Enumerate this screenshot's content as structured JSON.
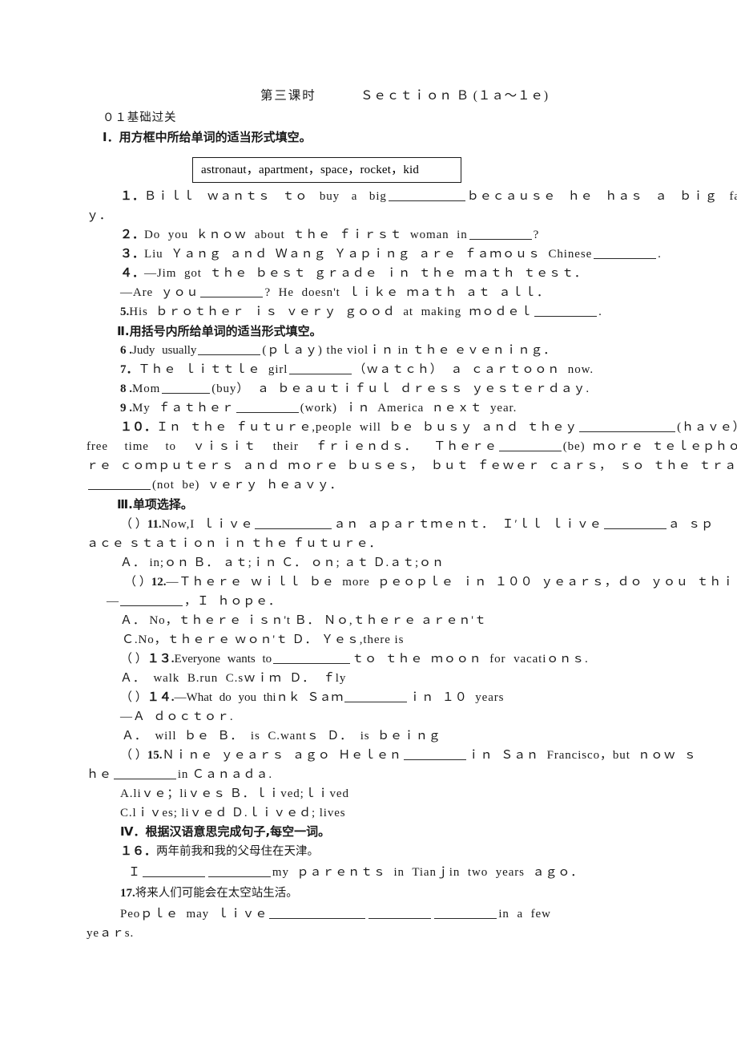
{
  "document": {
    "header": {
      "lesson_label": "第三课时",
      "section_label": "Ｓｅｃｔｉｏｎ Ｂ (１ａ～１ｅ)"
    },
    "part_label": "０１基础过关",
    "sections": [
      {
        "heading": "Ⅰ．用方框中所给单词的适当形式填空。",
        "word_bank": "astronaut，apartment，space，rocket，kid"
      },
      {
        "heading": "Ⅱ.用括号内所给单词的适当形式填空。"
      },
      {
        "heading": "Ⅲ.单项选择。"
      },
      {
        "heading": "Ⅳ．根据汉语意思完成句子,每空一词。"
      }
    ],
    "questions": [
      {
        "number": "１．",
        "lines": [
          "Ｂｉｌｌ ｗａｎｔｓ ｔｏ buy a big",
          "ｂｅｃａｕｓｅ ｈｅ ｈａｓ ａ ｂｉｇ famil",
          "ｙ．"
        ]
      },
      {
        "number": "２．",
        "lines": [
          "Do you ｋｎｏｗ about ｔｈｅ ｆｉｒｓｔ woman in",
          "?"
        ]
      },
      {
        "number": "３．",
        "lines": [
          "Liu Ｙａｎｇ ａｎｄ Ｗａｎｇ Ｙａｐｉｎｇ ａｒｅ ｆａｍｏｕｓ Chinese",
          "."
        ]
      },
      {
        "number": "４．",
        "lines": [
          "—Jim got ｔｈｅ ｂｅｓｔ ｇｒａｄｅ ｉｎ ｔｈｅ ｍａｔｈ ｔｅｓｔ．",
          "—Are ｙｏｕ",
          "? He doesn't ｌｉｋｅ ｍａｔｈ ａｔ ａｌｌ．"
        ]
      },
      {
        "number": "5.",
        "lines": [
          "His ｂｒｏｔｈｅｒ ｉｓ ｖｅｒｙ ｇｏｏｄ at making ｍｏｄｅｌ",
          "."
        ]
      },
      {
        "number": "6 .",
        "lines": [
          "Judy usually",
          "(ｐｌａｙ) the violｉｎ in ｔｈｅ ｅｖｅｎｉｎｇ．"
        ]
      },
      {
        "number": "7．",
        "lines": [
          "Ｔｈｅ ｌｉｔｔｌｅ girl",
          "（ｗａｔｃｈ） ａ ｃａｒｔｏｏｎ now."
        ]
      },
      {
        "number": "8 .",
        "lines": [
          "Mom",
          "(buy） ａ ｂｅａｕｔｉｆｕｌ ｄｒｅｓｓ ｙｅｓｔｅｒｄａｙ."
        ]
      },
      {
        "number": "9 .",
        "lines": [
          "My ｆａｔｈｅｒ",
          "(work) ｉｎ America ｎｅｘｔ year."
        ]
      },
      {
        "number": "１０．",
        "lines": [
          "Ｉｎ ｔｈｅ ｆｕｔｕｒｅ,people will ｂｅ ｂｕｓｙ ａｎｄ ｔｈｅｙ",
          "(ｈａｖｅ） ｌｅｓｓ",
          "free time to ｖｉｓｉｔ their ｆｒｉｅｎｄｓ． Ｔｈｅｒｅ",
          "(be) ｍｏｒｅ ｔｅｌｅｐｈｏｎｅｓ,ｍｏ",
          "ｒｅ ｃｏｍｐｕｔｅｒｓ ａｎｄ ｍｏｒｅ ｂｕｓｅｓ， ｂｕｔ ｆｅｗｅｒ ｃａｒｓ， ｓｏ ｔｈｅ ｔｒａｆｆｉｃ(交通)",
          "(not be) ｖｅｒｙ ｈｅａｖｙ．"
        ]
      },
      {
        "number": "11.",
        "bracket": "（    ）",
        "lines": [
          "Now,I ｌｉｖｅ",
          "ａｎ ａｐａｒｔｍｅｎｔ． Ｉ′ｌｌ ｌｉｖｅ",
          "ａ ｓｐ",
          "ａｃｅ ｓｔａｔｉｏｎ ｉｎ ｔｈｅ ｆｕｔｕｒｅ．"
        ],
        "options": "Ａ． in;ｏｎ  Ｂ． ａｔ;ｉｎ  Ｃ． ｏｎ; ａｔ  Ｄ.ａｔ;ｏｎ"
      },
      {
        "number": "12.",
        "bracket": "（    ）",
        "lines": [
          "—Ｔｈｅｒｅ ｗｉｌｌ ｂｅ more ｐｅｏｐｌｅ ｉｎ １００ ｙｅａｒｓ，ｄｏ ｙｏｕ ｔｈｉｎｋ",
          "—",
          "，Ｉ ｈｏｐｅ．"
        ],
        "options_line_1": "Ａ． No，ｔｈｅｒｅ ｉｓｎ't Ｂ． Ｎｏ,ｔｈｅｒｅ ａｒｅｎ'ｔ",
        "options_line_2": "Ｃ.No，ｔｈｅｒｅ ｗｏｎ'ｔ Ｄ． Ｙｅｓ,there is"
      },
      {
        "number": "１３.",
        "bracket": "（    ）",
        "lines": [
          "Everyone wants to",
          "ｔｏ ｔｈｅ ｍｏｏｎ for vacatiｏｎｓ."
        ],
        "options": "Ａ． walk  B.run    C.sｗｉｍ    Ｄ． ｆly"
      },
      {
        "number": "１４.",
        "bracket": "（    ）",
        "lines": [
          "—What do you thiｎｋ Ｓａｍ",
          "ｉｎ １０ years",
          "—Ａ ｄｏｃｔｏｒ."
        ],
        "options": "Ａ． will ｂｅ  Ｂ． is  C.wantｓ  Ｄ． is ｂｅｉｎｇ"
      },
      {
        "number": "15.",
        "bracket": "（    ）",
        "lines": [
          "Ｎｉｎｅ ｙｅａｒｓ ａｇｏ Ｈｅｌｅｎ",
          "ｉｎ Ｓａｎ Francisco，but ｎｏｗ ｓ",
          "ｈｅ",
          "in Ｃａｎａｄａ."
        ],
        "options_line_1": "A.liｖｅ；liｖｅｓ    Ｂ．ｌｉved;ｌｉved",
        "options_line_2": "C.lｉｖes;  liｖｅｄ  Ｄ.ｌｉｖｅｄ; lives"
      },
      {
        "number": "１６．",
        "chinese": "两年前我和我的父母住在天津。",
        "answer_line_prefix": "Ｉ",
        "answer_line_suffix": "my ｐａｒｅｎｔｓ in Tianｊin two years ａｇｏ．"
      },
      {
        "number": "17.",
        "chinese": "将来人们可能会在太空站生活。",
        "answer_line_prefix": "Peoｐｌｅ may ｌｉｖｅ",
        "answer_line_suffix": "in a few",
        "answer_line_suffix2": "yeａｒs."
      }
    ]
  }
}
